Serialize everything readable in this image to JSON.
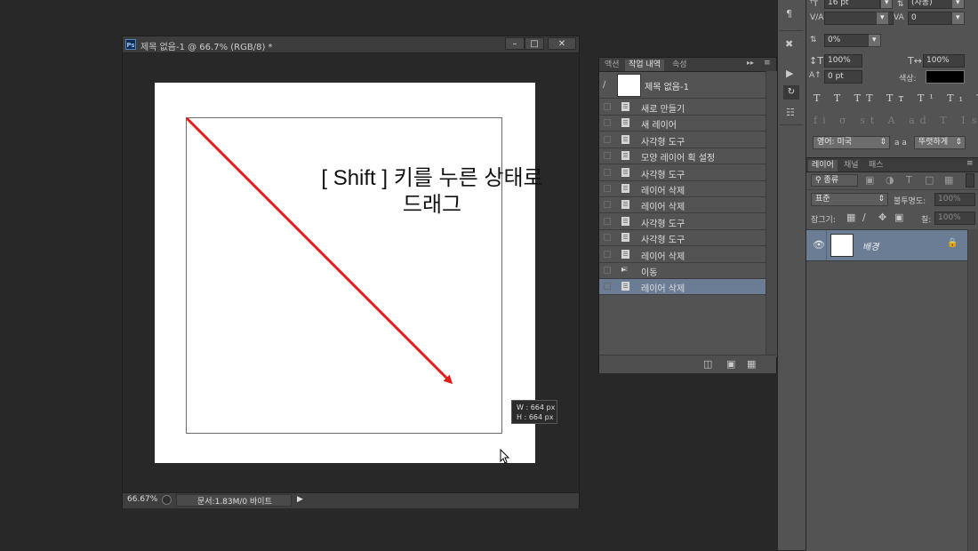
{
  "document": {
    "title": "제목 없음-1 @ 66.7% (RGB/8) *",
    "zoom": "66.67%",
    "status": "문서:1.83M/0 바이트",
    "measure": {
      "w_label": "W :",
      "w_value": "664 px",
      "h_label": "H :",
      "h_value": "664 px"
    }
  },
  "annotation": {
    "line1": "[ Shift ] 키를 누른 상태로",
    "line2": "드래그",
    "arrow_color": "#e81b1b"
  },
  "history_panel": {
    "tabs": [
      "액션",
      "작업 내역",
      "속성"
    ],
    "active_tab": "작업 내역",
    "snapshot_label": "제목 없음-1",
    "items": [
      {
        "label": "새로 만들기"
      },
      {
        "label": "새 레이어"
      },
      {
        "label": "사각형 도구"
      },
      {
        "label": "모양 레이어 획 설정"
      },
      {
        "label": "사각형 도구"
      },
      {
        "label": "레이어 삭제"
      },
      {
        "label": "레이어 삭제"
      },
      {
        "label": "사각형 도구"
      },
      {
        "label": "사각형 도구"
      },
      {
        "label": "레이어 삭제"
      },
      {
        "label": "이동"
      },
      {
        "label": "레이어 삭제"
      }
    ],
    "selected_index": 11
  },
  "character_panel": {
    "font_size": "16 pt",
    "leading": "(자동)",
    "tracking": "0",
    "scale_percent": "0%",
    "vertical_scale": "100%",
    "horizontal_scale": "100%",
    "baseline_shift": "0 pt",
    "color_label": "색상:",
    "language": "영어: 미국",
    "anti_alias": "뚜렷하게",
    "aa_label": "a a"
  },
  "layers_panel": {
    "tabs": [
      "레이어",
      "채널",
      "패스"
    ],
    "filter_kind": "종류",
    "blend_mode": "표준",
    "opacity_label": "불투명도:",
    "opacity_value": "100%",
    "lock_label": "잠그기:",
    "fill_label": "칠:",
    "fill_value": "100%",
    "layer_name": "배경"
  },
  "colors": {
    "accent_selected": "#6b7d95",
    "arrow": "#e81b1b"
  }
}
